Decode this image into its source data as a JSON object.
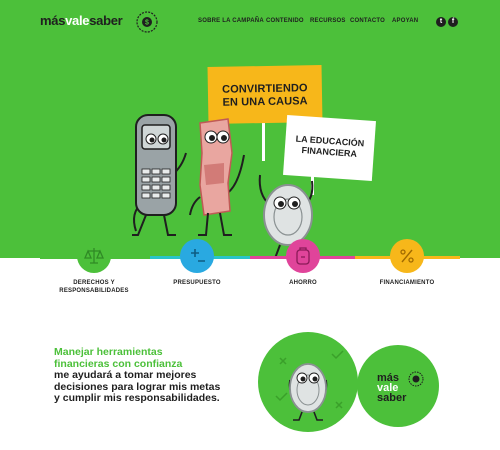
{
  "brand": {
    "logo_mas": "más",
    "logo_vale": "vale",
    "logo_saber": "saber",
    "colors": {
      "green": "#4cc03a",
      "yellow": "#f7b71a",
      "blue": "#29a9e1",
      "pink": "#e0449a",
      "teal": "#29c4c9",
      "dark": "#1f1f1f"
    }
  },
  "nav": {
    "items": [
      "SOBRE LA CAMPAÑA",
      "CONTENIDO",
      "RECURSOS",
      "CONTACTO",
      "APOYAN"
    ],
    "social": [
      {
        "icon": "twitter-icon",
        "glyph": "t"
      },
      {
        "icon": "facebook-icon",
        "glyph": "f"
      }
    ]
  },
  "hero": {
    "sign_main_line1": "CONVIRTIENDO",
    "sign_main_line2": "EN UNA CAUSA",
    "sign_secondary_line1": "LA EDUCACIÓN",
    "sign_secondary_line2": "FINANCIERA"
  },
  "categories": [
    {
      "label_line1": "DERECHOS Y",
      "label_line2": "RESPONSABILIDADES",
      "icon": "scales-icon",
      "color": "#4cc03a"
    },
    {
      "label_line1": "PRESUPUESTO",
      "label_line2": "",
      "icon": "plus-minus-icon",
      "color": "#29a9e1"
    },
    {
      "label_line1": "AHORRO",
      "label_line2": "",
      "icon": "piggy-bank-icon",
      "color": "#e0449a"
    },
    {
      "label_line1": "FINANCIAMIENTO",
      "label_line2": "",
      "icon": "percent-icon",
      "color": "#f7b71a"
    }
  ],
  "quote": {
    "line1": "Manejar herramientas",
    "line2": "financieras con confianza",
    "line3": "me ayudará a tomar mejores",
    "line4": "decisiones para lograr mis metas",
    "line5": "y cumplir mis responsabilidades."
  },
  "footer_brand": {
    "line1": "más",
    "line2": "vale",
    "line3": "saber"
  }
}
